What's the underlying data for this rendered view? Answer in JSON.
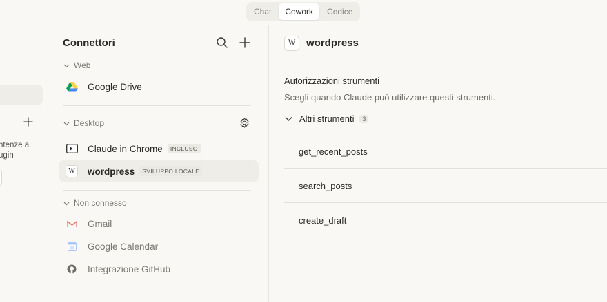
{
  "top_tabs": [
    "Chat",
    "Cowork",
    "Codice"
  ],
  "active_tab": "Cowork",
  "left_panel": {
    "partial_text": "ntenze a\nugin"
  },
  "connectors": {
    "title": "Connettori",
    "sections": {
      "web": "Web",
      "desktop": "Desktop",
      "not_connected": "Non connesso"
    },
    "items": {
      "google_drive": {
        "label": "Google Drive"
      },
      "claude_chrome": {
        "label": "Claude in Chrome",
        "badge": "INCLUSO"
      },
      "wordpress": {
        "label": "wordpress",
        "badge": "SVILUPPO LOCALE"
      },
      "gmail": {
        "label": "Gmail"
      },
      "google_calendar": {
        "label": "Google Calendar"
      },
      "github": {
        "label": "Integrazione GitHub"
      }
    }
  },
  "detail": {
    "icon_letter": "W",
    "title": "wordpress",
    "permissions_heading": "Autorizzazioni strumenti",
    "permissions_sub": "Scegli quando Claude può utilizzare questi strumenti.",
    "group_label": "Altri strumenti",
    "group_count": "3",
    "tools": [
      "get_recent_posts",
      "search_posts",
      "create_draft"
    ]
  },
  "colors": {
    "background": "#f9f8f5",
    "selected": "#efede8",
    "border": "#e6e4de"
  }
}
